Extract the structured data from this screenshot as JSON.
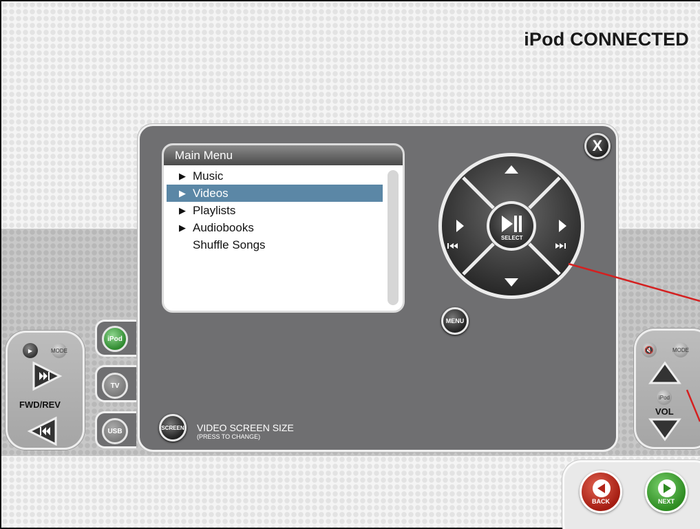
{
  "title": "iPod CONNECTED",
  "menu": {
    "header": "Main Menu",
    "items": [
      {
        "label": "Music",
        "arrow": true,
        "selected": false
      },
      {
        "label": "Videos",
        "arrow": true,
        "selected": true
      },
      {
        "label": "Playlists",
        "arrow": true,
        "selected": false
      },
      {
        "label": "Audiobooks",
        "arrow": true,
        "selected": false
      },
      {
        "label": "Shuffle Songs",
        "arrow": false,
        "selected": false
      }
    ]
  },
  "dpad": {
    "select_label": "SELECT",
    "menu_label": "MENU"
  },
  "close_label": "X",
  "sources": [
    {
      "label": "iPod",
      "active": true
    },
    {
      "label": "TV",
      "active": false
    },
    {
      "label": "USB",
      "active": false
    }
  ],
  "screen": {
    "button_label": "SCREEN",
    "line1": "VIDEO SCREEN SIZE",
    "line2": "(PRESS TO CHANGE)"
  },
  "left_remote": {
    "mode_label": "MODE",
    "label": "FWD/REV"
  },
  "right_remote": {
    "mode_label": "MODE",
    "source_label": "iPod",
    "label": "VOL"
  },
  "nav": {
    "back_label": "BACK",
    "next_label": "NEXT"
  },
  "colors": {
    "selected_row": "#5b87a6",
    "panel": "#6f6f71",
    "annotation_line": "#d42020"
  }
}
